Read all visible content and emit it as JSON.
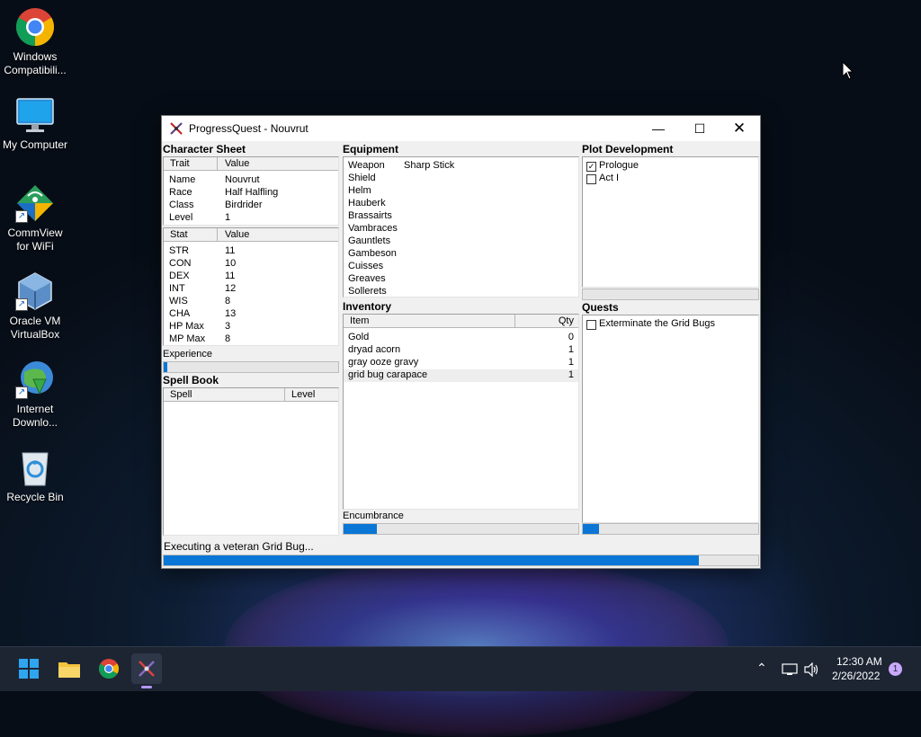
{
  "desktop": {
    "icons": [
      {
        "label": "Windows Compatibili...",
        "icon": "chrome-icon"
      },
      {
        "label": "My Computer",
        "icon": "monitor-icon"
      },
      {
        "label": "CommView for WiFi",
        "icon": "commview-icon"
      },
      {
        "label": "Oracle VM VirtualBox",
        "icon": "virtualbox-icon"
      },
      {
        "label": "Internet Downlo...",
        "icon": "internet-download-icon"
      },
      {
        "label": "Recycle Bin",
        "icon": "recycle-bin-icon"
      }
    ]
  },
  "window": {
    "title": "ProgressQuest - Nouvrut",
    "character_sheet": {
      "label": "Character Sheet",
      "trait_header": "Trait",
      "value_header": "Value",
      "traits": [
        {
          "name": "Name",
          "value": "Nouvrut"
        },
        {
          "name": "Race",
          "value": "Half Halfling"
        },
        {
          "name": "Class",
          "value": "Birdrider"
        },
        {
          "name": "Level",
          "value": "1"
        }
      ],
      "stat_header": "Stat",
      "stat_value_header": "Value",
      "stats": [
        {
          "name": "STR",
          "value": "11"
        },
        {
          "name": "CON",
          "value": "10"
        },
        {
          "name": "DEX",
          "value": "11"
        },
        {
          "name": "INT",
          "value": "12"
        },
        {
          "name": "WIS",
          "value": "8"
        },
        {
          "name": "CHA",
          "value": "13"
        },
        {
          "name": "HP Max",
          "value": "3"
        },
        {
          "name": "MP Max",
          "value": "8"
        }
      ],
      "experience_label": "Experience",
      "experience_progress": 0.02
    },
    "spell_book": {
      "label": "Spell Book",
      "spell_header": "Spell",
      "level_header": "Level"
    },
    "equipment": {
      "label": "Equipment",
      "items": [
        {
          "slot": "Weapon",
          "item": "Sharp Stick"
        },
        {
          "slot": "Shield",
          "item": ""
        },
        {
          "slot": "Helm",
          "item": ""
        },
        {
          "slot": "Hauberk",
          "item": ""
        },
        {
          "slot": "Brassairts",
          "item": ""
        },
        {
          "slot": "Vambraces",
          "item": ""
        },
        {
          "slot": "Gauntlets",
          "item": ""
        },
        {
          "slot": "Gambeson",
          "item": ""
        },
        {
          "slot": "Cuisses",
          "item": ""
        },
        {
          "slot": "Greaves",
          "item": ""
        },
        {
          "slot": "Sollerets",
          "item": ""
        }
      ]
    },
    "inventory": {
      "label": "Inventory",
      "item_header": "Item",
      "qty_header": "Qty",
      "items": [
        {
          "name": "Gold",
          "qty": "0"
        },
        {
          "name": "dryad acorn",
          "qty": "1"
        },
        {
          "name": "gray ooze gravy",
          "qty": "1"
        },
        {
          "name": "grid bug carapace",
          "qty": "1"
        }
      ],
      "encumbrance_label": "Encumbrance",
      "encumbrance_progress": 0.14
    },
    "plot": {
      "label": "Plot Development",
      "acts": [
        {
          "name": "Prologue",
          "checked": true
        },
        {
          "name": "Act I",
          "checked": false
        }
      ]
    },
    "quests": {
      "label": "Quests",
      "items": [
        {
          "name": "Exterminate the Grid Bugs",
          "checked": false
        }
      ],
      "progress": 0.09
    },
    "status_text": "Executing a veteran Grid Bug...",
    "task_progress": 0.9
  },
  "taskbar": {
    "time": "12:30 AM",
    "date": "2/26/2022",
    "notification_count": "1"
  },
  "colors": {
    "accent": "#0a76d6",
    "taskbar": "#1d2533"
  }
}
